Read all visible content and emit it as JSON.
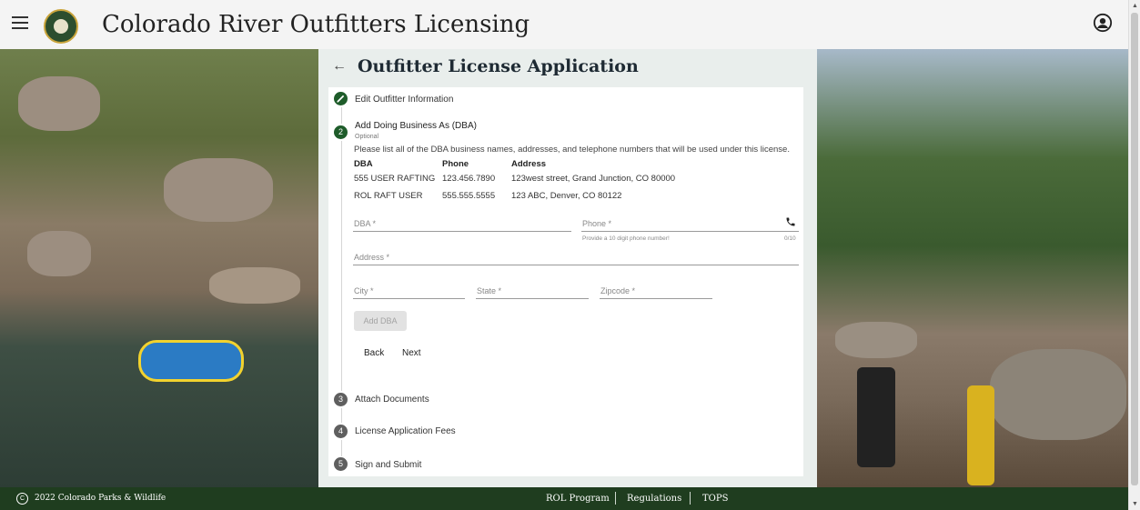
{
  "header": {
    "title": "Colorado River Outfitters Licensing"
  },
  "page": {
    "heading": "Outfitter License Application"
  },
  "steps": [
    {
      "number": "",
      "label": "Edit Outfitter Information"
    },
    {
      "number": "2",
      "label": "Add Doing Business As (DBA)",
      "sublabel": "Optional"
    },
    {
      "number": "3",
      "label": "Attach Documents"
    },
    {
      "number": "4",
      "label": "License Application Fees"
    },
    {
      "number": "5",
      "label": "Sign and Submit"
    }
  ],
  "dba": {
    "instructions": "Please list all of the DBA business names, addresses, and telephone numbers that will be used under this license.",
    "headers": [
      "DBA",
      "Phone",
      "Address"
    ],
    "rows": [
      [
        "555 USER RAFTING",
        "123.456.7890",
        "123west street, Grand Junction, CO 80000"
      ],
      [
        "ROL RAFT USER",
        "555.555.5555",
        "123 ABC, Denver, CO 80122"
      ]
    ],
    "fields": {
      "dba": "DBA *",
      "phone": "Phone *",
      "phone_hint": "Provide a 10 digit phone number!",
      "phone_counter": "0/10",
      "address": "Address *",
      "city": "City *",
      "state": "State *",
      "zipcode": "Zipcode *"
    },
    "add_button": "Add DBA",
    "back_button": "Back",
    "next_button": "Next"
  },
  "footer": {
    "copyright": "2022 Colorado Parks & Wildlife",
    "links": [
      "ROL Program",
      "Regulations",
      "TOPS"
    ]
  },
  "colors": {
    "step_done": "#1e5c2a",
    "step_pending": "#5f5f5f",
    "footer_bg": "#1f3d1f"
  }
}
